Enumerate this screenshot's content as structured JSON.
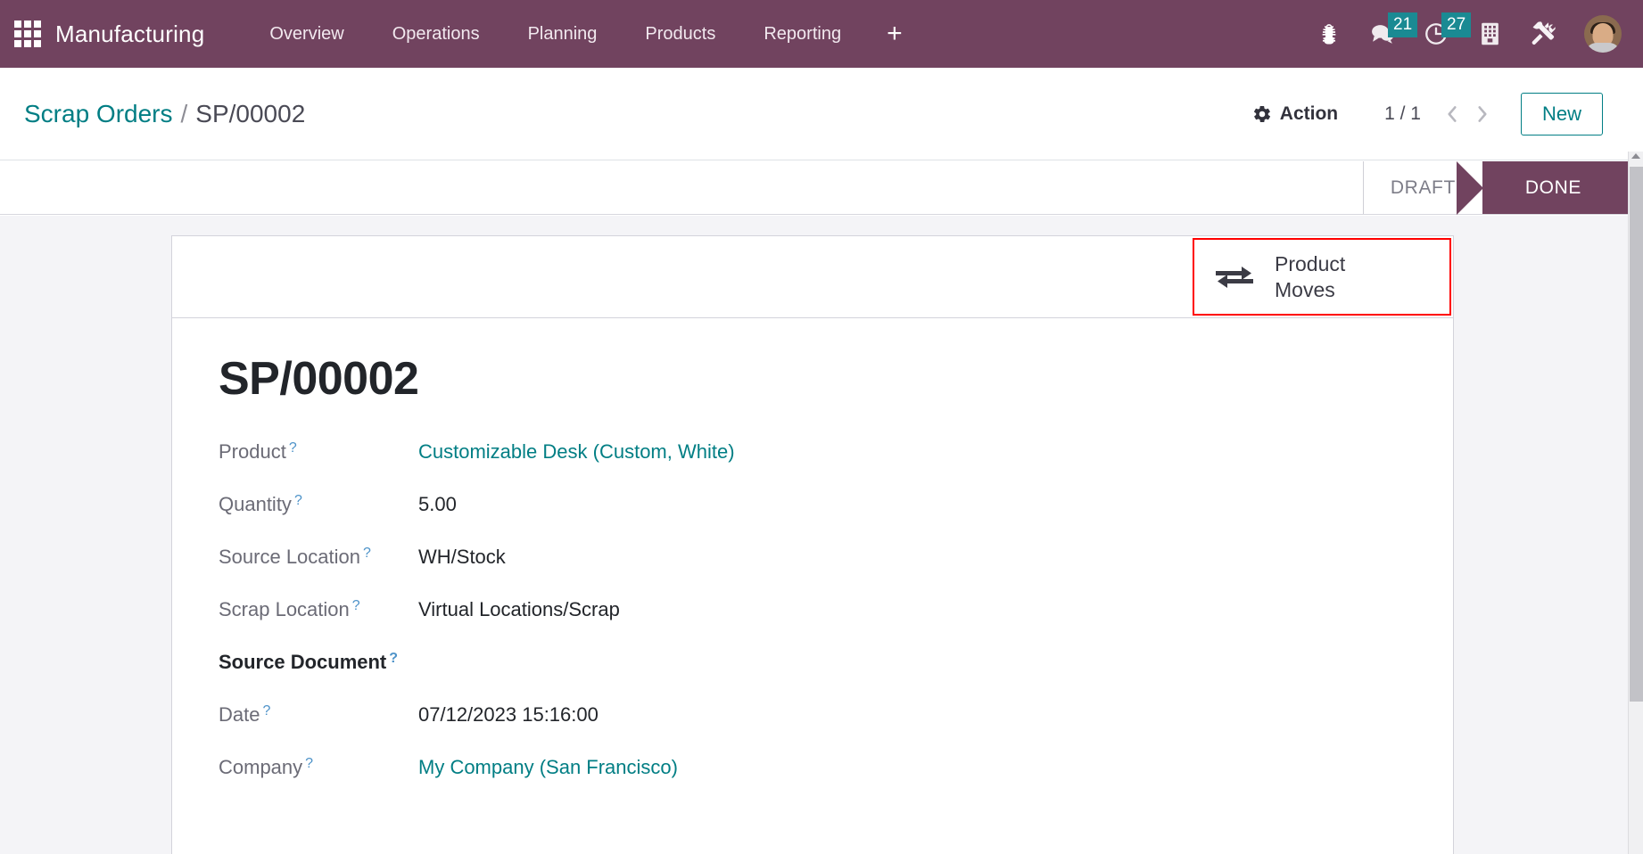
{
  "navbar": {
    "apps_icon": "apps-grid-icon",
    "brand": "Manufacturing",
    "menu_items": [
      {
        "label": "Overview"
      },
      {
        "label": "Operations"
      },
      {
        "label": "Planning"
      },
      {
        "label": "Products"
      },
      {
        "label": "Reporting"
      }
    ],
    "add_label": "+",
    "icons": [
      {
        "name": "bug-icon",
        "badge": null
      },
      {
        "name": "messages-icon",
        "badge": "21"
      },
      {
        "name": "activities-clock-icon",
        "badge": "27"
      },
      {
        "name": "company-building-icon",
        "badge": null
      },
      {
        "name": "developer-tools-icon",
        "badge": null
      }
    ],
    "avatar_name": "user-avatar",
    "background_color": "#71435F",
    "badge_color": "#1a8a93"
  },
  "control_panel": {
    "breadcrumb": {
      "parent": "Scrap Orders",
      "separator": "/",
      "current": "SP/00002"
    },
    "action_label": "Action",
    "pager": {
      "value": "1 / 1",
      "previous_icon": "chevron-left-icon",
      "next_icon": "chevron-right-icon"
    },
    "new_label": "New",
    "accent_color": "#017e84"
  },
  "statusbar": {
    "stages": [
      {
        "label": "DRAFT",
        "active": false
      },
      {
        "label": "DONE",
        "active": true
      }
    ],
    "active_color": "#71435F"
  },
  "form": {
    "smart_button": {
      "icon": "exchange-arrows-icon",
      "label_line1": "Product",
      "label_line2": "Moves",
      "highlight_color": "#ff0000"
    },
    "title": "SP/00002",
    "fields": [
      {
        "label": "Product",
        "tooltip": "?",
        "value": "Customizable Desk (Custom, White)",
        "is_link": true,
        "bold_label": false
      },
      {
        "label": "Quantity",
        "tooltip": "?",
        "value": "5.00",
        "is_link": false,
        "bold_label": false
      },
      {
        "label": "Source Location",
        "tooltip": "?",
        "value": "WH/Stock",
        "is_link": false,
        "bold_label": false
      },
      {
        "label": "Scrap Location",
        "tooltip": "?",
        "value": "Virtual Locations/Scrap",
        "is_link": false,
        "bold_label": false
      },
      {
        "label": "Source Document",
        "tooltip": "?",
        "value": "",
        "is_link": false,
        "bold_label": true
      },
      {
        "label": "Date",
        "tooltip": "?",
        "value": "07/12/2023 15:16:00",
        "is_link": false,
        "bold_label": false
      },
      {
        "label": "Company",
        "tooltip": "?",
        "value": "My Company (San Francisco)",
        "is_link": true,
        "bold_label": false
      }
    ]
  }
}
